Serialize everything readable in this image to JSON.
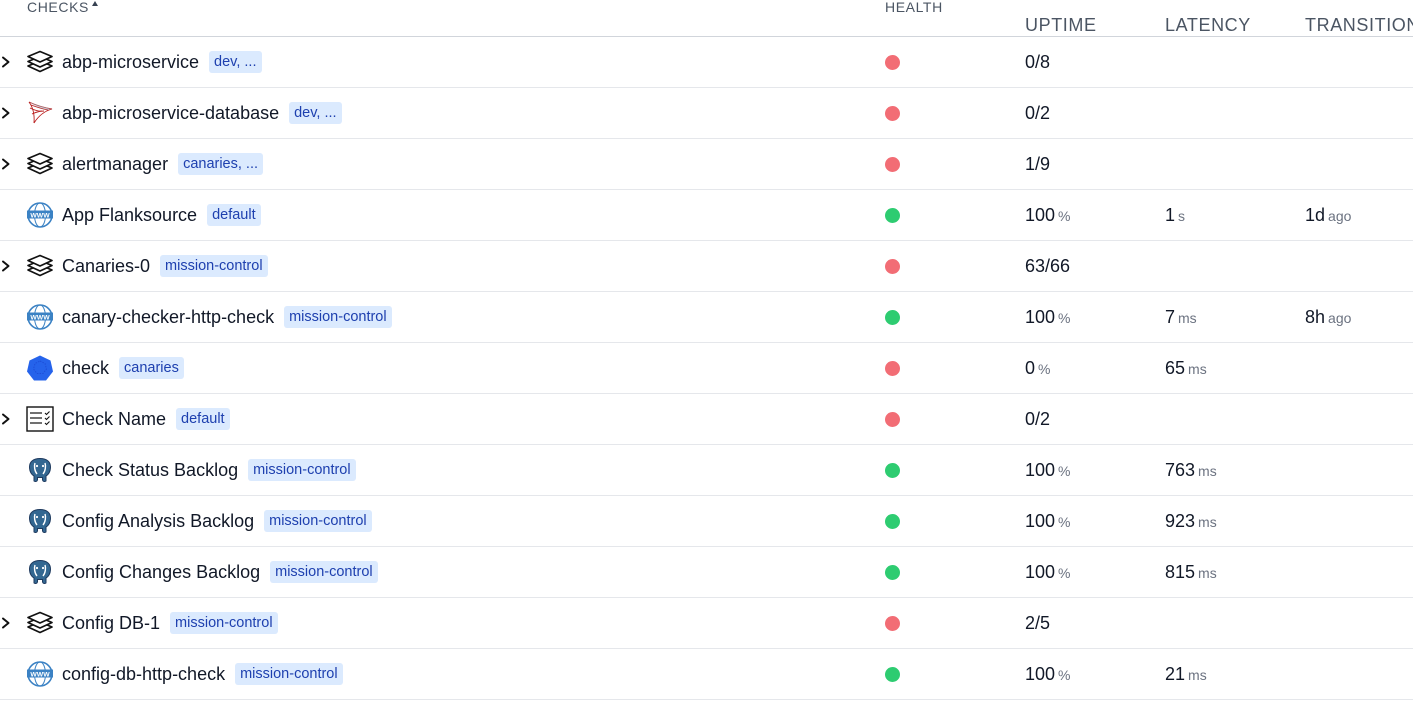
{
  "header": {
    "checks": "Checks",
    "health": "Health",
    "uptime": "Uptime",
    "latency": "Latency",
    "transition": "Transition"
  },
  "colors": {
    "unhealthy": "#f26d75",
    "healthy": "#2ecc71",
    "tag_bg": "#dbeafe",
    "tag_text": "#1e40af"
  },
  "rows": [
    {
      "name": "abp-microservice",
      "tag": "dev, ...",
      "icon": "layers-icon",
      "expandable": true,
      "health": "unhealthy",
      "uptime": "0/8",
      "uptime_unit": "",
      "latency": "",
      "latency_unit": "",
      "transition": "",
      "transition_unit": ""
    },
    {
      "name": "abp-microservice-database",
      "tag": "dev, ...",
      "icon": "sql-server-icon",
      "expandable": true,
      "health": "unhealthy",
      "uptime": "0/2",
      "uptime_unit": "",
      "latency": "",
      "latency_unit": "",
      "transition": "",
      "transition_unit": ""
    },
    {
      "name": "alertmanager",
      "tag": "canaries, ...",
      "icon": "layers-icon",
      "expandable": true,
      "health": "unhealthy",
      "uptime": "1/9",
      "uptime_unit": "",
      "latency": "",
      "latency_unit": "",
      "transition": "",
      "transition_unit": ""
    },
    {
      "name": "App Flanksource",
      "tag": "default",
      "icon": "www-icon",
      "expandable": false,
      "health": "healthy",
      "uptime": "100",
      "uptime_unit": "%",
      "latency": "1",
      "latency_unit": "s",
      "transition": "1d",
      "transition_unit": "ago"
    },
    {
      "name": "Canaries-0",
      "tag": "mission-control",
      "icon": "layers-icon",
      "expandable": true,
      "health": "unhealthy",
      "uptime": "63/66",
      "uptime_unit": "",
      "latency": "",
      "latency_unit": "",
      "transition": "",
      "transition_unit": ""
    },
    {
      "name": "canary-checker-http-check",
      "tag": "mission-control",
      "icon": "www-icon",
      "expandable": false,
      "health": "healthy",
      "uptime": "100",
      "uptime_unit": "%",
      "latency": "7",
      "latency_unit": "ms",
      "transition": "8h",
      "transition_unit": "ago"
    },
    {
      "name": "check",
      "tag": "canaries",
      "icon": "kubernetes-icon",
      "expandable": false,
      "health": "unhealthy",
      "uptime": "0",
      "uptime_unit": "%",
      "latency": "65",
      "latency_unit": "ms",
      "transition": "",
      "transition_unit": ""
    },
    {
      "name": "Check Name",
      "tag": "default",
      "icon": "checklist-icon",
      "expandable": true,
      "health": "unhealthy",
      "uptime": "0/2",
      "uptime_unit": "",
      "latency": "",
      "latency_unit": "",
      "transition": "",
      "transition_unit": ""
    },
    {
      "name": "Check Status Backlog",
      "tag": "mission-control",
      "icon": "postgres-icon",
      "expandable": false,
      "health": "healthy",
      "uptime": "100",
      "uptime_unit": "%",
      "latency": "763",
      "latency_unit": "ms",
      "transition": "",
      "transition_unit": ""
    },
    {
      "name": "Config Analysis Backlog",
      "tag": "mission-control",
      "icon": "postgres-icon",
      "expandable": false,
      "health": "healthy",
      "uptime": "100",
      "uptime_unit": "%",
      "latency": "923",
      "latency_unit": "ms",
      "transition": "",
      "transition_unit": ""
    },
    {
      "name": "Config Changes Backlog",
      "tag": "mission-control",
      "icon": "postgres-icon",
      "expandable": false,
      "health": "healthy",
      "uptime": "100",
      "uptime_unit": "%",
      "latency": "815",
      "latency_unit": "ms",
      "transition": "",
      "transition_unit": ""
    },
    {
      "name": "Config DB-1",
      "tag": "mission-control",
      "icon": "layers-icon",
      "expandable": true,
      "health": "unhealthy",
      "uptime": "2/5",
      "uptime_unit": "",
      "latency": "",
      "latency_unit": "",
      "transition": "",
      "transition_unit": ""
    },
    {
      "name": "config-db-http-check",
      "tag": "mission-control",
      "icon": "www-icon",
      "expandable": false,
      "health": "healthy",
      "uptime": "100",
      "uptime_unit": "%",
      "latency": "21",
      "latency_unit": "ms",
      "transition": "",
      "transition_unit": ""
    }
  ]
}
